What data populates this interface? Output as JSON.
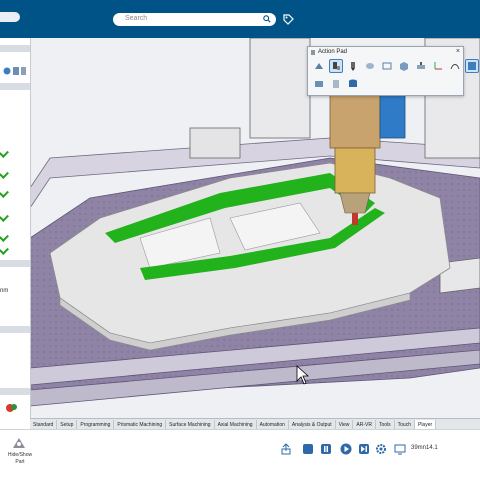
{
  "header": {
    "search_placeholder": "Search"
  },
  "action_pad": {
    "title": "Action Pad",
    "close": "×"
  },
  "left_panel": {
    "partial_text": "nm"
  },
  "tabs": [
    "Standard",
    "Setup",
    "Programming",
    "Prismatic Machining",
    "Surface Machining",
    "Axial Machining",
    "Automation",
    "Analysis & Output",
    "View",
    "AR-VR",
    "Tools",
    "Touch",
    "Player"
  ],
  "active_tab": "Player",
  "bottom": {
    "hide_show_label": "Hide/Show Part",
    "speed": "39mn14.1"
  },
  "colors": {
    "topbar": "#005386",
    "toolpath": "#22b21c",
    "part": "#e6e6e6",
    "table": "#8a7f9e"
  }
}
